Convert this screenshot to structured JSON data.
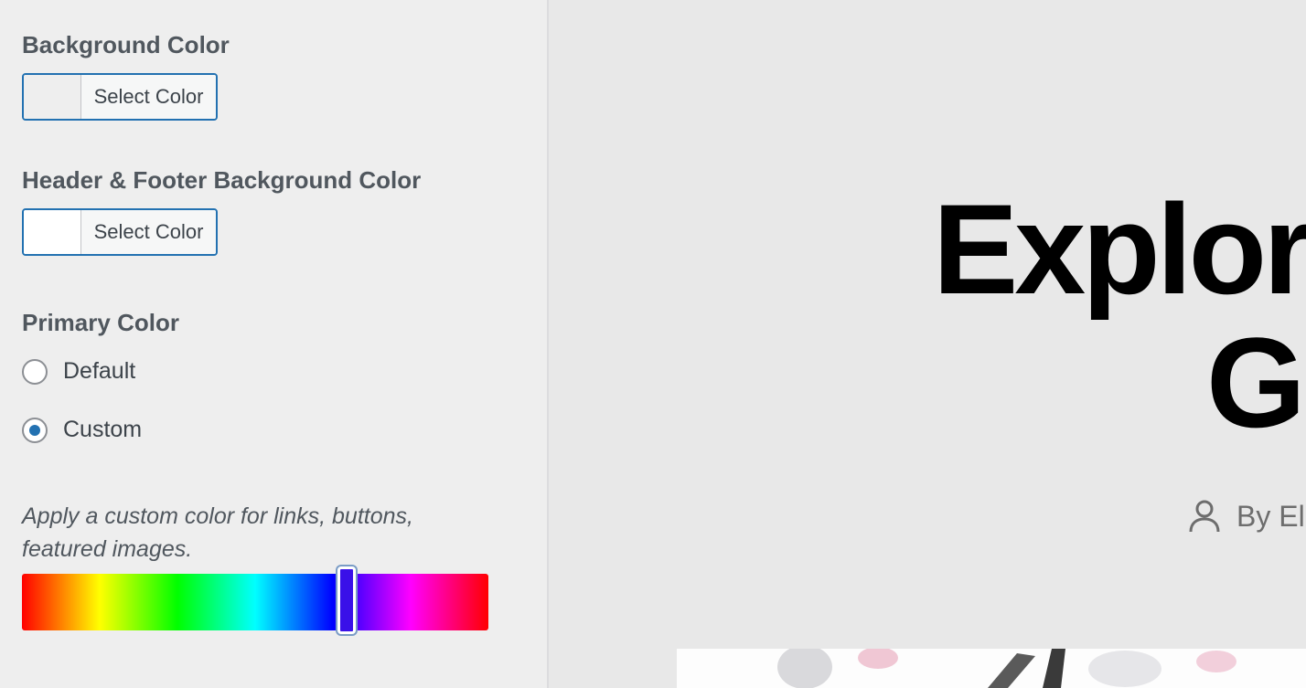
{
  "customizer": {
    "background_color": {
      "title": "Background Color",
      "button_label": "Select Color",
      "swatch": "#eeeeee"
    },
    "header_footer_color": {
      "title": "Header & Footer Background Color",
      "button_label": "Select Color",
      "swatch": "#ffffff"
    },
    "primary_color": {
      "title": "Primary Color",
      "options": [
        {
          "label": "Default",
          "checked": false
        },
        {
          "label": "Custom",
          "checked": true
        }
      ],
      "description": "Apply a custom color for links, buttons, featured images.",
      "hue_value": 0.697,
      "selected_color": "#3a10e8"
    }
  },
  "preview": {
    "title_line1": "Explorin",
    "title_line2": "Gut",
    "byline": "By El",
    "author_icon": "user-icon"
  },
  "colors": {
    "accent": "#2271b1",
    "text": "#50575e",
    "panel_bg": "#eeeeee",
    "preview_bg": "#e8e8e8"
  }
}
